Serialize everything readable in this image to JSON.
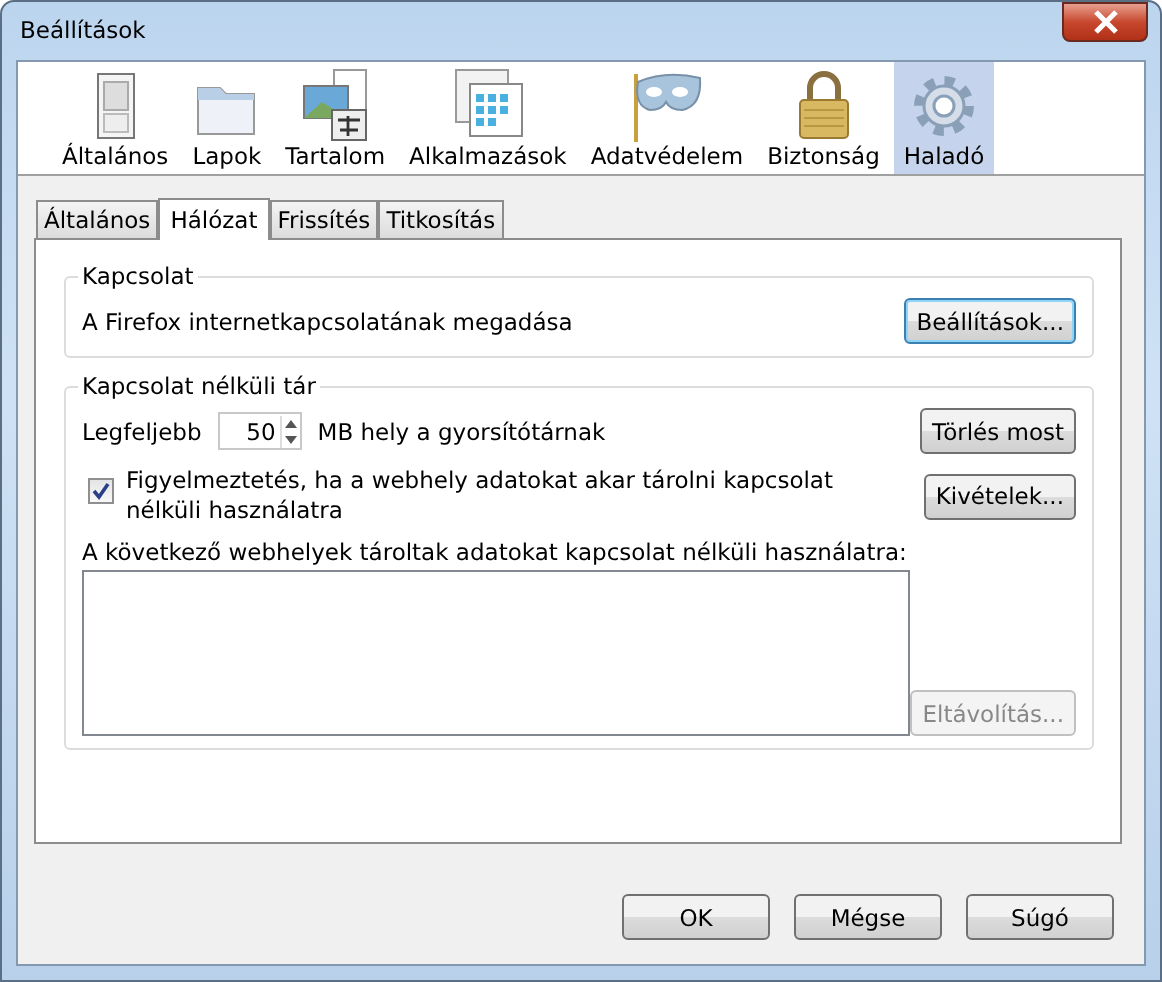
{
  "window": {
    "title": "Beállítások"
  },
  "categories": [
    {
      "label": "Általános",
      "selected": false
    },
    {
      "label": "Lapok",
      "selected": false
    },
    {
      "label": "Tartalom",
      "selected": false
    },
    {
      "label": "Alkalmazások",
      "selected": false
    },
    {
      "label": "Adatvédelem",
      "selected": false
    },
    {
      "label": "Biztonság",
      "selected": false
    },
    {
      "label": "Haladó",
      "selected": true
    }
  ],
  "tabs": [
    {
      "label": "Általános",
      "selected": false
    },
    {
      "label": "Hálózat",
      "selected": true
    },
    {
      "label": "Frissítés",
      "selected": false
    },
    {
      "label": "Titkosítás",
      "selected": false
    }
  ],
  "connection": {
    "legend": "Kapcsolat",
    "description": "A Firefox internetkapcsolatának megadása",
    "button": "Beállítások..."
  },
  "offline": {
    "legend": "Kapcsolat nélküli tár",
    "limit_label": "Legfeljebb",
    "limit_value": "50",
    "unit_label": "MB hely a gyorsítótárnak",
    "clear_button": "Törlés most",
    "warn": {
      "label": "Figyelmeztetés, ha a webhely adatokat akar tárolni kapcsolat nélküli használatra",
      "checked": true
    },
    "exceptions_button": "Kivételek...",
    "list_label": "A következő webhelyek tároltak adatokat kapcsolat nélküli használatra:",
    "remove_button": {
      "label": "Eltávolítás...",
      "disabled": true
    }
  },
  "buttons": [
    "OK",
    "Mégse",
    "Súgó"
  ]
}
